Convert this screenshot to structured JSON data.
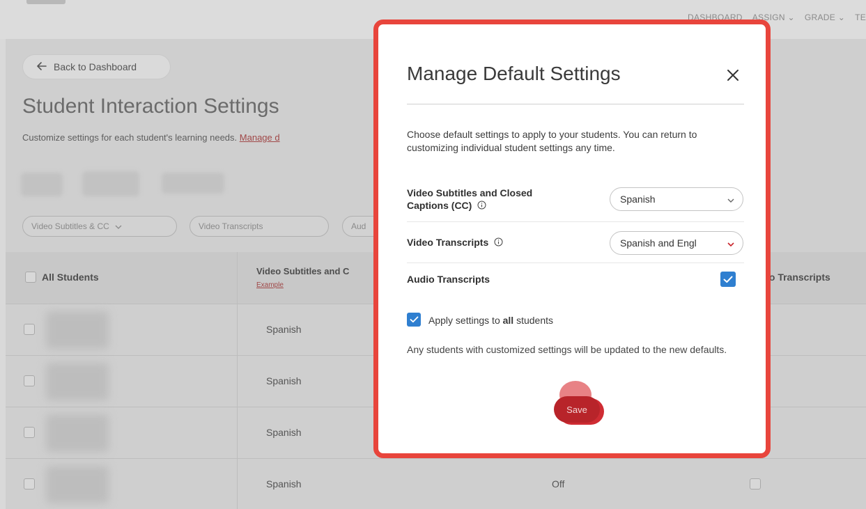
{
  "top_nav": {
    "items": [
      "DASHBOARD",
      "ASSIGN ⌄",
      "GRADE ⌄",
      "TE"
    ]
  },
  "page": {
    "back_label": "Back to Dashboard",
    "title": "Student Interaction Settings",
    "subtitle": "Customize settings for each student's learning needs.",
    "subtitle_link": "Manage d"
  },
  "filters": {
    "chip1": "Video Subtitles & CC",
    "chip2": "Video Transcripts",
    "chip3": "Aud"
  },
  "table": {
    "col_students": "All Students",
    "col_subtitles": "Video Subtitles and C",
    "col_subtitles_example": "Example",
    "col_audio": "io Transcripts",
    "rows": [
      {
        "lang": "Spanish",
        "audio": ""
      },
      {
        "lang": "Spanish",
        "audio": ""
      },
      {
        "lang": "Spanish",
        "audio": ""
      },
      {
        "lang": "Spanish",
        "audio": "Off"
      }
    ]
  },
  "modal": {
    "title": "Manage Default Settings",
    "description": "Choose default settings to apply to your students. You can return to customizing individual student settings any time.",
    "video_subtitles_label": "Video Subtitles and Closed Captions (CC)",
    "video_subtitles_value": "Spanish",
    "video_transcripts_label": "Video Transcripts",
    "video_transcripts_value": "Spanish and Engl",
    "audio_transcripts_label": "Audio Transcripts",
    "audio_transcripts_checked": true,
    "apply_prefix": "Apply settings to ",
    "apply_bold": "all",
    "apply_suffix": " students",
    "apply_checked": true,
    "note": "Any students with customized settings will be updated to the new defaults.",
    "save_label": "Save"
  },
  "colors": {
    "highlight_border": "#e8453c",
    "checkbox_blue": "#2f7fd0",
    "save_red": "#b8242a"
  }
}
